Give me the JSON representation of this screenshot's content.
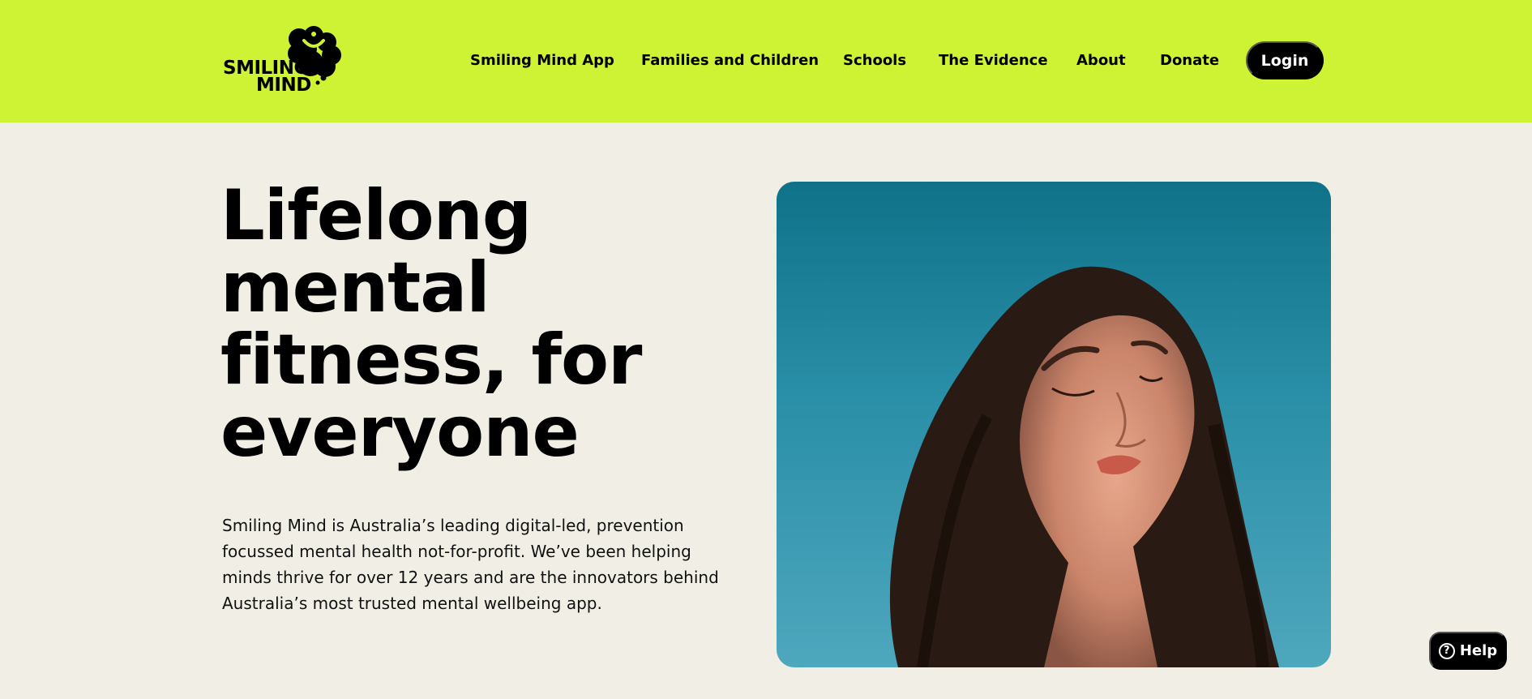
{
  "colors": {
    "header_bg": "#cef234",
    "page_bg": "#f1efe5",
    "button_bg": "#000000",
    "button_text": "#ffffff"
  },
  "logo": {
    "line1": "SMILING",
    "line2": "MIND",
    "icon": "smiling-brain-icon"
  },
  "nav": {
    "items": [
      "Smiling Mind App",
      "Families and Children",
      "Schools",
      "The Evidence",
      "About",
      "Donate"
    ],
    "login_label": "Login"
  },
  "hero": {
    "title": "Lifelong mental fitness, for everyone",
    "description": "Smiling Mind is Australia’s leading digital-led, prevention focussed mental health not-for-profit. We’ve been helping minds thrive for over 12 years and are the innovators behind Australia’s most trusted mental wellbeing app."
  },
  "help": {
    "label": "Help",
    "icon": "question-circle-icon"
  }
}
